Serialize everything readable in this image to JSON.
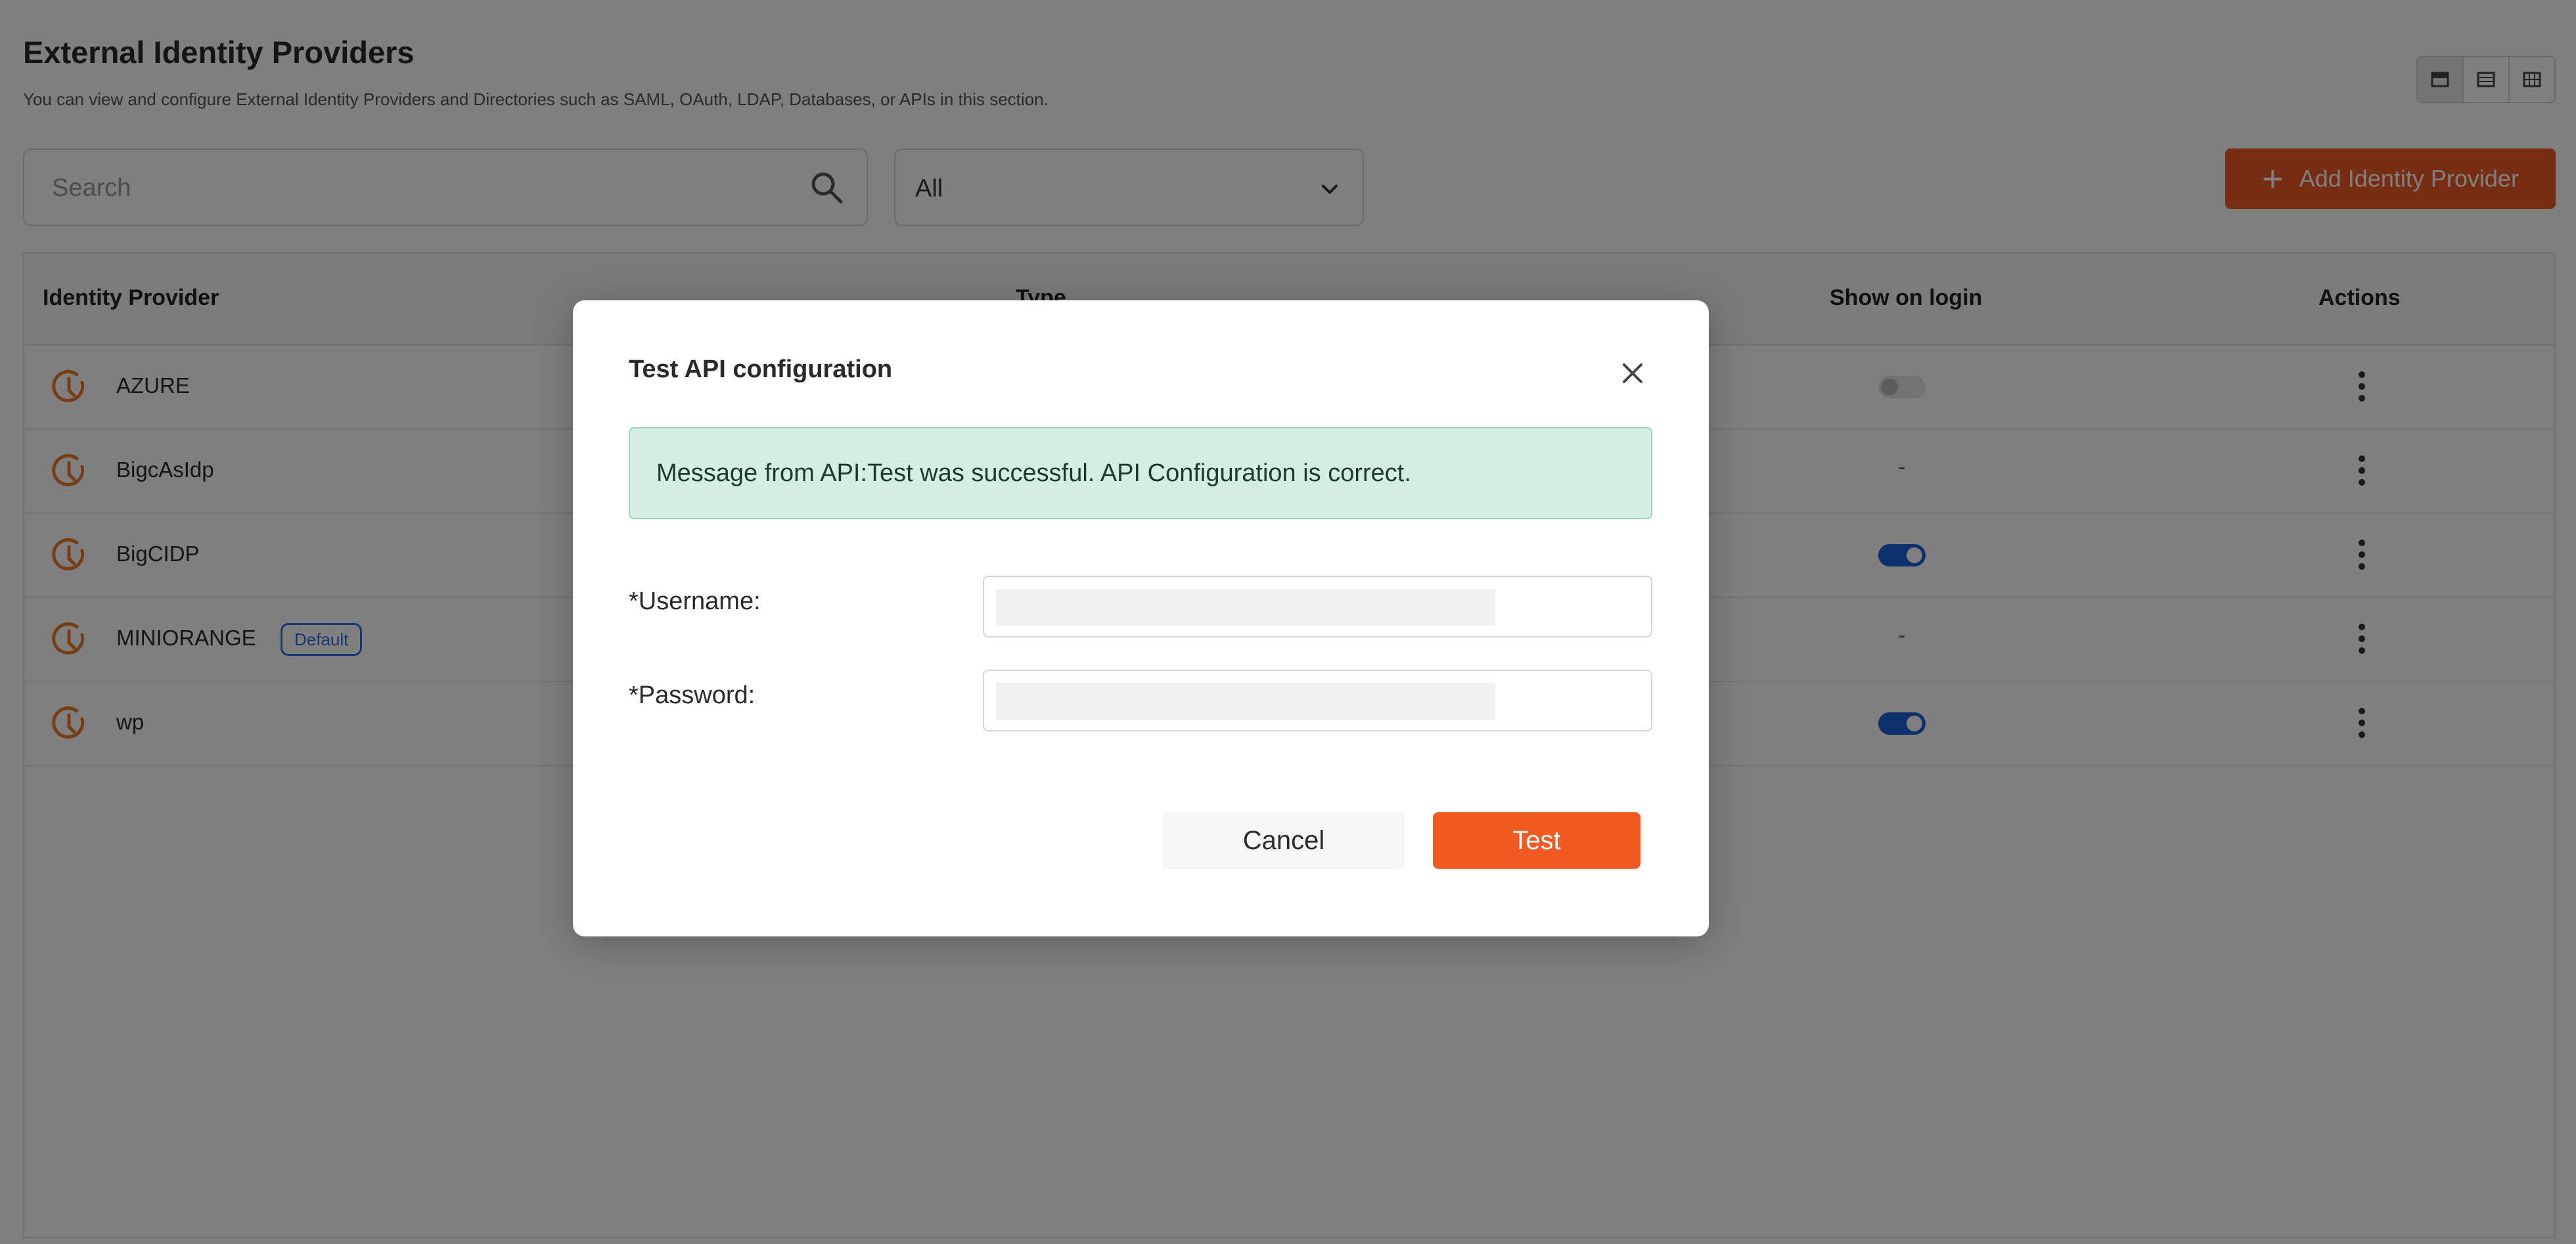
{
  "page": {
    "title": "External Identity Providers",
    "description": "You can view and configure External Identity Providers and Directories such as SAML, OAuth, LDAP, Databases, or APIs in this section."
  },
  "toolbar": {
    "search_placeholder": "Search",
    "filter_value": "All",
    "add_button_label": "Add Identity Provider"
  },
  "table": {
    "columns": [
      "Identity Provider",
      "Type",
      "Show on login",
      "Actions"
    ],
    "rows": [
      {
        "name": "AZURE",
        "badge": "",
        "show_on_login": "off"
      },
      {
        "name": "BigcAsIdp",
        "badge": "",
        "show_on_login": "-"
      },
      {
        "name": "BigCIDP",
        "badge": "",
        "show_on_login": "on"
      },
      {
        "name": "MINIORANGE",
        "badge": "Default",
        "show_on_login": "-"
      },
      {
        "name": "wp",
        "badge": "",
        "show_on_login": "on"
      }
    ]
  },
  "modal": {
    "title": "Test API configuration",
    "alert": "Message from API:Test was successful. API Configuration is correct.",
    "username_label": "*Username:",
    "password_label": "*Password:",
    "cancel_label": "Cancel",
    "test_label": "Test"
  },
  "colors": {
    "accent": "#ef5a23",
    "toggle_on": "#1a5fd6",
    "success_bg": "#d4eee3",
    "badge": "#2f6ee0"
  },
  "icons": [
    "search-icon",
    "chevron-down-icon",
    "plus-icon",
    "provider-logo-icon",
    "kebab-menu-icon",
    "close-icon",
    "card-view-icon",
    "list-view-icon",
    "grid-view-icon"
  ]
}
